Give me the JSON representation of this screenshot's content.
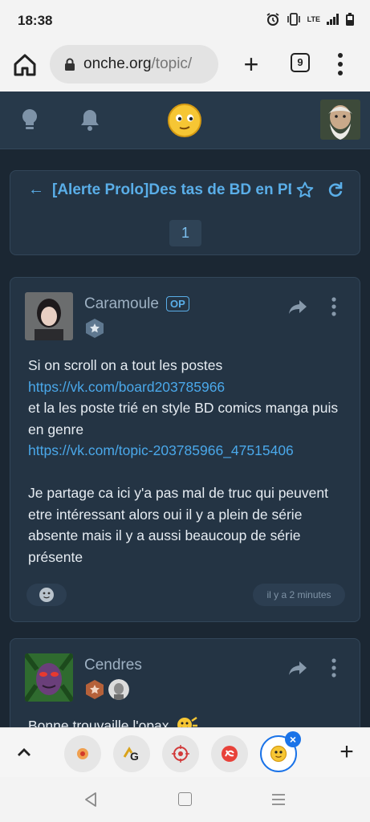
{
  "status_bar": {
    "time": "18:38",
    "network": "LTE"
  },
  "browser": {
    "url_domain": "onche.org",
    "url_path": "/topic/",
    "tab_count": "9"
  },
  "topic": {
    "title": "[Alerte Prolo]Des tas de BD en PDF",
    "page": "1"
  },
  "posts": [
    {
      "author": "Caramoule",
      "op_label": "OP",
      "body": [
        "Si on scroll on a tout les postes",
        "https://vk.com/board203785966",
        "et la les poste trié en style BD comics manga puis en genre",
        "https://vk.com/topic-203785966_47515406",
        "",
        "Je partage ca ici y'a pas mal de truc qui peuvent etre intéressant alors oui il y a plein de série absente mais il y a aussi beaucoup de série présente"
      ],
      "time": "il y a 2 minutes"
    },
    {
      "author": "Cendres",
      "body_first_line": "Bonne trouvaille l'opax"
    }
  ],
  "colors": {
    "link": "#4aa8ea",
    "card_bg": "#243444",
    "page_bg": "#1b2733",
    "accent_blue": "#1a73e8"
  }
}
